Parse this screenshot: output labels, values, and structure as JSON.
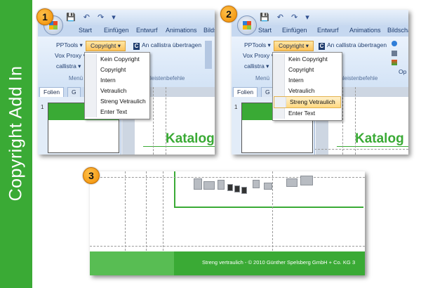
{
  "title": "Copyright Add In",
  "colors": {
    "brand_green": "#3aaa35",
    "ribbon_blue": "#d3e3f6",
    "highlight": "#ffd982"
  },
  "ribbon": {
    "tabs": [
      "Start",
      "Einfügen",
      "Entwurf",
      "Animations",
      "Bildsc"
    ],
    "tabs_step2": [
      "Start",
      "Einfügen",
      "Entwurf",
      "Animations",
      "Bildscha"
    ],
    "pptools": "PPTools",
    "voxproxy": "Vox Proxy",
    "callistra": "callistra",
    "copyright_button": "Copyright",
    "an_callistra": "An callistra übertragen",
    "menue_caption": "Menü",
    "leistenbefehle": "leistenbefehle",
    "leistenbefehle_2": "enleistenbefehle",
    "op": "Op"
  },
  "menu": {
    "items": [
      "Kein Copyright",
      "Copyright",
      "Intern",
      "Vetraulich",
      "Streng Vetraulich",
      "Enter Text"
    ],
    "highlighted_in_step2": "Streng Vetraulich"
  },
  "slides_panel": {
    "tab_folien": "Folien",
    "tab_g": "G",
    "slide_number": "1"
  },
  "slide": {
    "heading": "Katalog"
  },
  "steps": [
    "1",
    "2",
    "3"
  ],
  "footer": {
    "text": "Streng vertraulich - © 2010 Günther Spelsberg GmbH + Co. KG",
    "page": "3"
  }
}
